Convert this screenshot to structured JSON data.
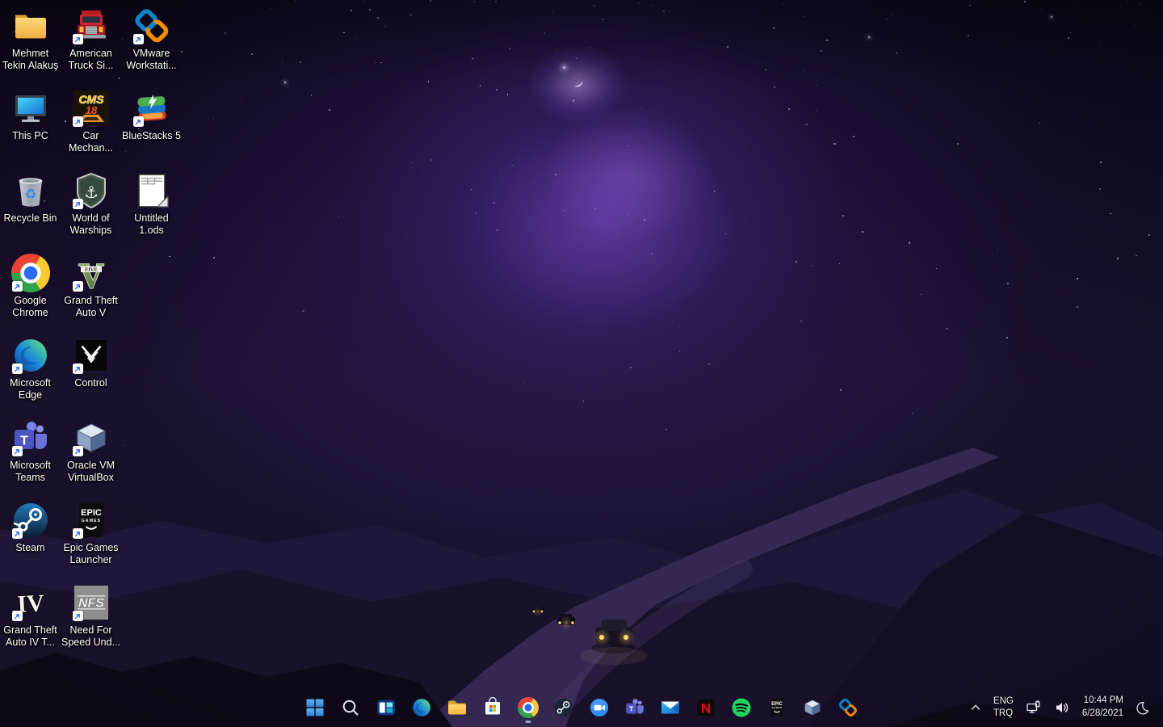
{
  "wallpaper": {
    "description": "purple night-sky artwork with nebula clouds, crescent moon, dark mountains and a road with cars",
    "accent_purple": "#5c3fa0",
    "sky_dark": "#0a0613",
    "mountain_dark": "#191129"
  },
  "desktop": {
    "icons": [
      {
        "name": "user-folder",
        "icon": "folder",
        "label": "Mehmet\nTekin Alakuş",
        "shortcut": false
      },
      {
        "name": "this-pc",
        "icon": "thispc",
        "label": "This PC",
        "shortcut": false
      },
      {
        "name": "recycle-bin",
        "icon": "recycle",
        "label": "Recycle Bin",
        "shortcut": false
      },
      {
        "name": "google-chrome",
        "icon": "chrome",
        "label": "Google\nChrome",
        "shortcut": true
      },
      {
        "name": "microsoft-edge",
        "icon": "edge",
        "label": "Microsoft\nEdge",
        "shortcut": true
      },
      {
        "name": "microsoft-teams",
        "icon": "teams",
        "label": "Microsoft\nTeams",
        "shortcut": true
      },
      {
        "name": "steam",
        "icon": "steam",
        "label": "Steam",
        "shortcut": true
      },
      {
        "name": "gta-iv",
        "icon": "gta4",
        "label": "Grand Theft\nAuto IV T...",
        "shortcut": true
      },
      {
        "name": "american-truck-simulator",
        "icon": "truck",
        "label": "American\nTruck Si...",
        "shortcut": true
      },
      {
        "name": "car-mechanic-simulator",
        "icon": "cms18",
        "label": "Car\nMechan...",
        "shortcut": true
      },
      {
        "name": "world-of-warships",
        "icon": "wows",
        "label": "World of\nWarships",
        "shortcut": true
      },
      {
        "name": "gta-v",
        "icon": "gtav",
        "label": "Grand Theft\nAuto V",
        "shortcut": true
      },
      {
        "name": "control",
        "icon": "control",
        "label": "Control",
        "shortcut": true
      },
      {
        "name": "oracle-virtualbox",
        "icon": "vbox",
        "label": "Oracle VM\nVirtualBox",
        "shortcut": true
      },
      {
        "name": "epic-games-launcher",
        "icon": "epic",
        "label": "Epic Games\nLauncher",
        "shortcut": true
      },
      {
        "name": "nfs-undercover",
        "icon": "nfs",
        "label": "Need For\nSpeed Und...",
        "shortcut": true
      },
      {
        "name": "vmware-workstation",
        "icon": "vmware",
        "label": "VMware\nWorkstati...",
        "shortcut": true
      },
      {
        "name": "bluestacks-5",
        "icon": "bluestacks",
        "label": "BlueStacks 5",
        "shortcut": true
      },
      {
        "name": "untitled-ods",
        "icon": "ods",
        "label": "Untitled\n1.ods",
        "shortcut": false
      }
    ]
  },
  "taskbar": {
    "items": [
      {
        "name": "start",
        "icon": "start",
        "running": false
      },
      {
        "name": "search",
        "icon": "search",
        "running": false
      },
      {
        "name": "task-view",
        "icon": "taskview",
        "running": false
      },
      {
        "name": "edge",
        "icon": "edge",
        "running": false
      },
      {
        "name": "file-explorer",
        "icon": "explorer",
        "running": false
      },
      {
        "name": "microsoft-store",
        "icon": "store",
        "running": false
      },
      {
        "name": "chrome",
        "icon": "chrome",
        "running": true
      },
      {
        "name": "steam",
        "icon": "steamdark",
        "running": false
      },
      {
        "name": "zoom",
        "icon": "zoomapp",
        "running": false
      },
      {
        "name": "teams",
        "icon": "teams",
        "running": false
      },
      {
        "name": "mail",
        "icon": "mail",
        "running": false
      },
      {
        "name": "netflix",
        "icon": "netflix",
        "running": false
      },
      {
        "name": "spotify",
        "icon": "spotify",
        "running": false
      },
      {
        "name": "epic-games",
        "icon": "epic",
        "running": false
      },
      {
        "name": "virtualbox",
        "icon": "vbox",
        "running": false
      },
      {
        "name": "vmware",
        "icon": "vmware",
        "running": false
      }
    ],
    "tray": {
      "language_primary": "ENG",
      "language_secondary": "TRQ",
      "time": "10:44 PM",
      "date": "6/28/2021"
    }
  }
}
